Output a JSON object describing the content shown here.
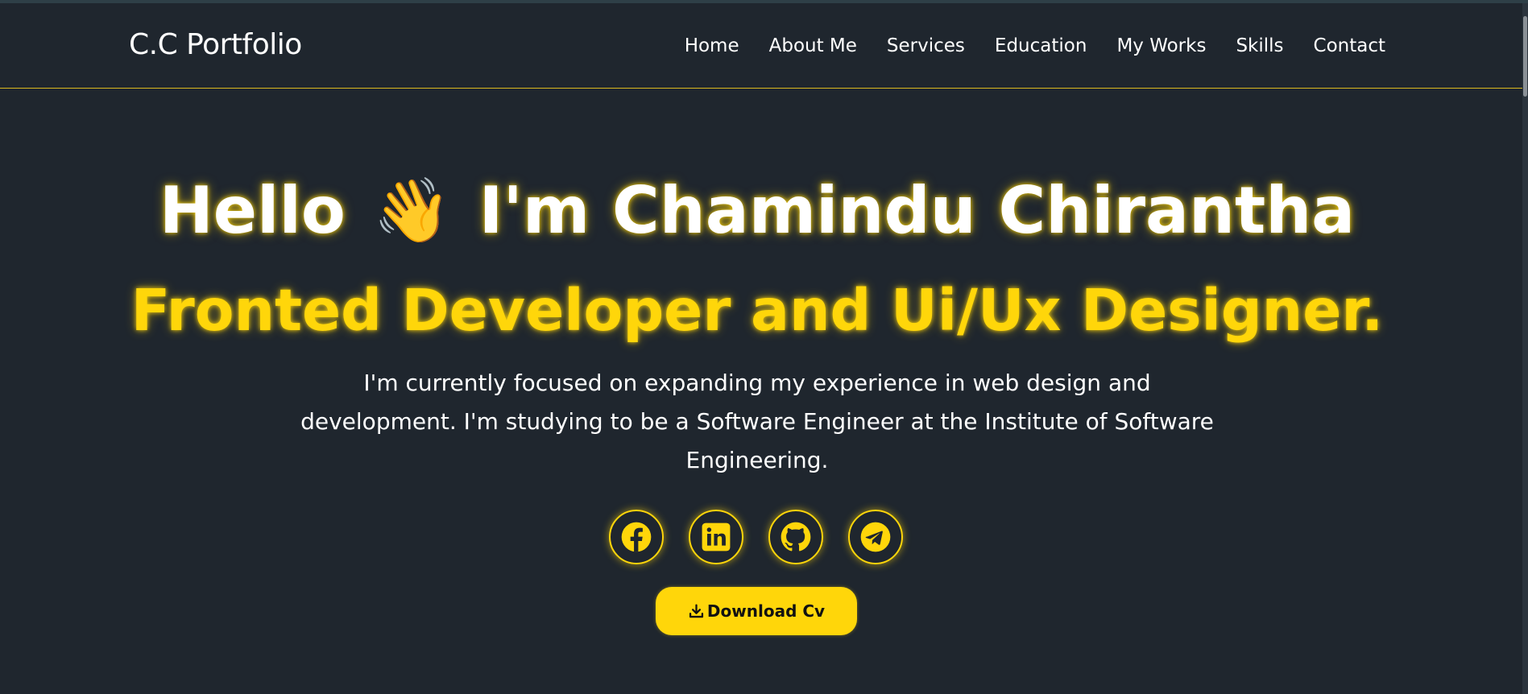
{
  "navbar": {
    "brand": "C.C Portfolio",
    "links": [
      {
        "label": "Home",
        "name": "nav-link-home"
      },
      {
        "label": "About Me",
        "name": "nav-link-about-me"
      },
      {
        "label": "Services",
        "name": "nav-link-services"
      },
      {
        "label": "Education",
        "name": "nav-link-education"
      },
      {
        "label": "My Works",
        "name": "nav-link-my-works"
      },
      {
        "label": "Skills",
        "name": "nav-link-skills"
      },
      {
        "label": "Contact",
        "name": "nav-link-contact"
      }
    ]
  },
  "hero": {
    "greeting": "Hello",
    "wave_emoji": "👋",
    "name_line": "I'm Chamindu Chirantha",
    "subtitle": "Fronted Developer and Ui/Ux Designer.",
    "description_lines": [
      "I'm currently focused on expanding my experience in web design and",
      "development. I'm studying to be a Software Engineer at the Institute of Software",
      "Engineering."
    ]
  },
  "socials": [
    {
      "name": "facebook-link",
      "icon": "facebook-icon"
    },
    {
      "name": "linkedin-link",
      "icon": "linkedin-icon"
    },
    {
      "name": "github-link",
      "icon": "github-icon"
    },
    {
      "name": "telegram-link",
      "icon": "telegram-icon"
    }
  ],
  "download": {
    "label": "Download Cv",
    "icon": "download-icon"
  },
  "colors": {
    "background": "#1f262e",
    "accent": "#ffd60a",
    "text": "#ffffff",
    "nav_divider": "#d9b81f"
  }
}
